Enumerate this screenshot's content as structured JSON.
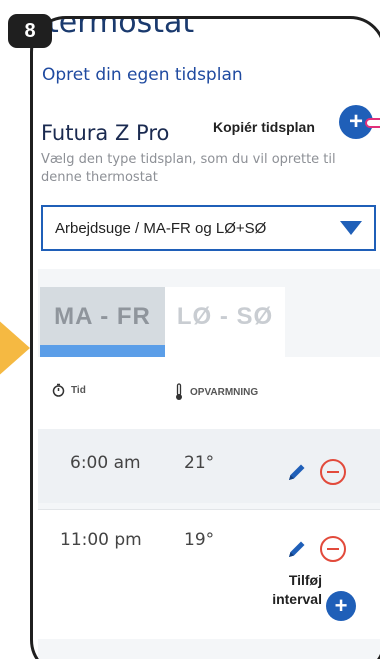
{
  "step": {
    "number": "8"
  },
  "header": {
    "cut_title": "termostat",
    "subtitle": "Opret din egen tidsplan",
    "device_name": "Futura Z Pro",
    "copy_label": "Kopiér tidsplan",
    "copy_icon": "plus-icon",
    "hint": "Vælg den type tidsplan, som du vil oprette til denne thermostat"
  },
  "schedule_select": {
    "value": "Arbejdsuge / MA-FR og LØ+SØ",
    "icon": "caret-down-icon"
  },
  "tabs": [
    {
      "label": "MA - FR",
      "selected": true
    },
    {
      "label": "LØ - SØ",
      "selected": false
    }
  ],
  "table": {
    "col_time": "Tid",
    "col_heat": "OPVARMNING",
    "rows": [
      {
        "time": "6:00 am",
        "temp": "21°"
      },
      {
        "time": "11:00 pm",
        "temp": "19°"
      }
    ]
  },
  "add_interval": {
    "label": "Tilføj interval"
  },
  "colors": {
    "accent": "#1f5fb8",
    "tab_underline": "#5b9ee8",
    "remove": "#e24a3b",
    "pointer": "#f5b942",
    "pin": "#e0307a"
  }
}
